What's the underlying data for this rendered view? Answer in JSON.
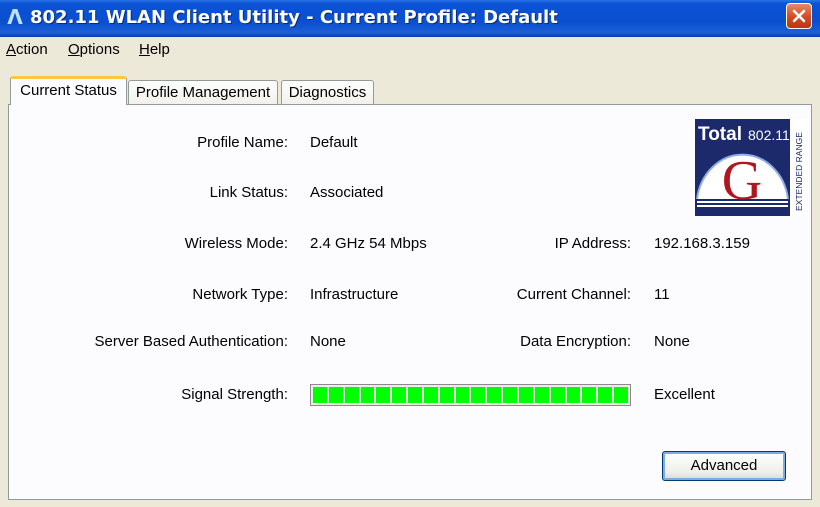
{
  "window": {
    "title": "802.11 WLAN Client Utility - Current Profile: Default",
    "app_icon": "Λ"
  },
  "menu": {
    "items": [
      {
        "label_ul": "A",
        "label_rest": "ction"
      },
      {
        "label_ul": "O",
        "label_rest": "ptions"
      },
      {
        "label_ul": "H",
        "label_rest": "elp"
      }
    ]
  },
  "tabs": [
    "Current Status",
    "Profile Management",
    "Diagnostics"
  ],
  "status": {
    "profile_name_label": "Profile Name:",
    "profile_name": "Default",
    "link_status_label": "Link Status:",
    "link_status": "Associated",
    "wireless_mode_label": "Wireless Mode:",
    "wireless_mode": "2.4 GHz 54 Mbps",
    "ip_address_label": "IP Address:",
    "ip_address": "192.168.3.159",
    "network_type_label": "Network Type:",
    "network_type": "Infrastructure",
    "current_channel_label": "Current Channel:",
    "current_channel": "11",
    "server_auth_label": "Server Based Authentication:",
    "server_auth": "None",
    "data_encryption_label": "Data Encryption:",
    "data_encryption": "None",
    "signal_strength_label": "Signal Strength:",
    "signal_strength": "Excellent",
    "signal_level": 1.0,
    "signal_segments": 20
  },
  "logo": {
    "top_text": "Total",
    "top_number": "802.11",
    "letter": "G",
    "side_text": "EXTENDED RANGE"
  },
  "buttons": {
    "advanced": "Advanced"
  },
  "colors": {
    "signal_bar": "#00ff00",
    "titlebar": "#0b4fd0",
    "active_tab_accent": "#ffc83c"
  }
}
